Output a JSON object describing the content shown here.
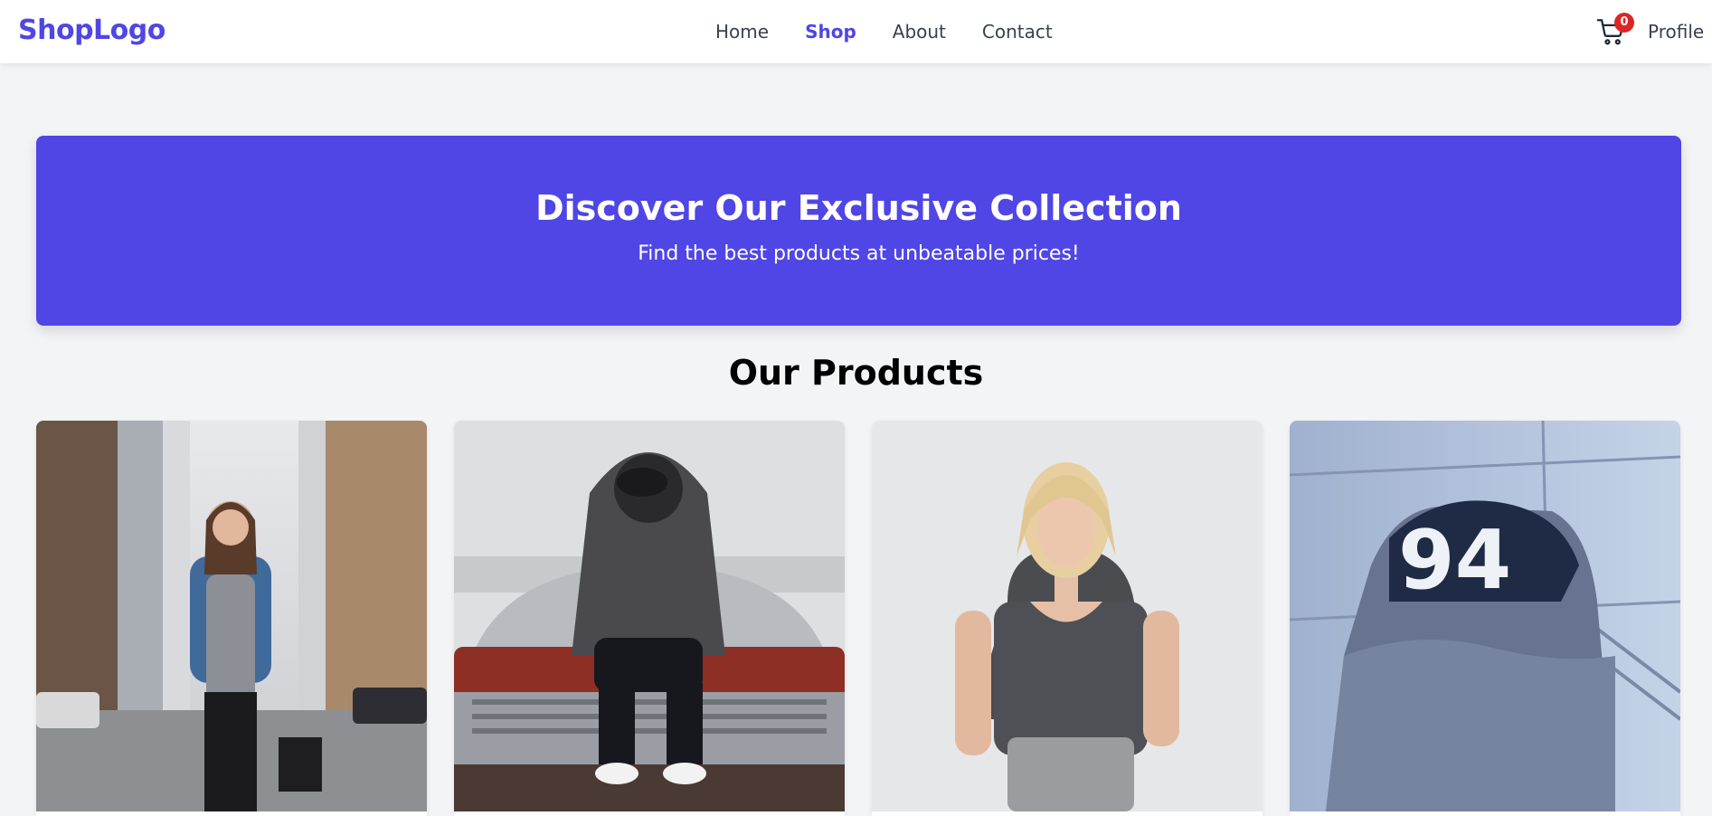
{
  "header": {
    "logo": "ShopLogo",
    "nav": [
      {
        "label": "Home",
        "active": false
      },
      {
        "label": "Shop",
        "active": true
      },
      {
        "label": "About",
        "active": false
      },
      {
        "label": "Contact",
        "active": false
      }
    ],
    "cart_count": "0",
    "profile_label": "Profile"
  },
  "hero": {
    "title": "Discover Our Exclusive Collection",
    "subtitle": "Find the best products at unbeatable prices!"
  },
  "products_section": {
    "title": "Our Products"
  },
  "colors": {
    "brand": "#4f46e5",
    "badge": "#dc2626",
    "background": "#f3f4f6"
  }
}
